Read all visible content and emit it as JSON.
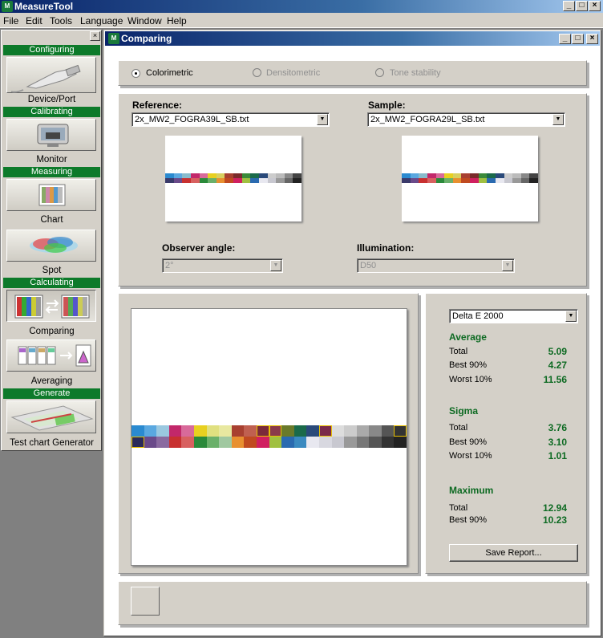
{
  "app": {
    "title": "MeasureTool",
    "icon": "measuretool-app-icon"
  },
  "menu": [
    "File",
    "Edit",
    "Tools",
    "Language",
    "Window",
    "Help"
  ],
  "nav": {
    "sections": [
      {
        "header": "Configuring",
        "item": "Device/Port",
        "icon": "usb-cable-icon"
      },
      {
        "header": "Calibrating",
        "item": "Monitor",
        "icon": "monitor-icon"
      },
      {
        "header": "Measuring",
        "item": "Chart",
        "icon": "color-chart-icon"
      },
      {
        "header": "",
        "item": "Spot",
        "icon": "color-spot-icon"
      },
      {
        "header": "Calculating",
        "item": "Comparing",
        "icon": "compare-charts-icon"
      },
      {
        "header": "",
        "item": "Averaging",
        "icon": "averaging-icon"
      },
      {
        "header": "Generate",
        "item": "Test chart Generator",
        "icon": "test-chart-generator-icon"
      }
    ],
    "active": "Comparing"
  },
  "window": {
    "title": "Comparing"
  },
  "modes": {
    "colorimetric": "Colorimetric",
    "densitometric": "Densitometric",
    "tone_stability": "Tone stability",
    "selected": "Colorimetric"
  },
  "reference": {
    "label": "Reference:",
    "file": "2x_MW2_FOGRA39L_SB.txt"
  },
  "sample": {
    "label": "Sample:",
    "file": "2x_MW2_FOGRA29L_SB.txt"
  },
  "observer": {
    "label": "Observer angle:",
    "value": "2°"
  },
  "illumination": {
    "label": "Illumination:",
    "value": "D50"
  },
  "metric": {
    "value": "Delta E 2000"
  },
  "stats": {
    "average": {
      "title": "Average",
      "total_label": "Total",
      "total": "5.09",
      "best_label": "Best 90%",
      "best": "4.27",
      "worst_label": "Worst 10%",
      "worst": "11.56"
    },
    "sigma": {
      "title": "Sigma",
      "total_label": "Total",
      "total": "3.76",
      "best_label": "Best 90%",
      "best": "3.10",
      "worst_label": "Worst 10%",
      "worst": "1.01"
    },
    "maximum": {
      "title": "Maximum",
      "total_label": "Total",
      "total": "12.94",
      "best_label": "Best 90%",
      "best": "10.23"
    }
  },
  "save_report": "Save Report...",
  "colors": {
    "accent_green": "#0d7a2a",
    "value_green": "#0d6a22",
    "title_blue": "#0a246a"
  }
}
